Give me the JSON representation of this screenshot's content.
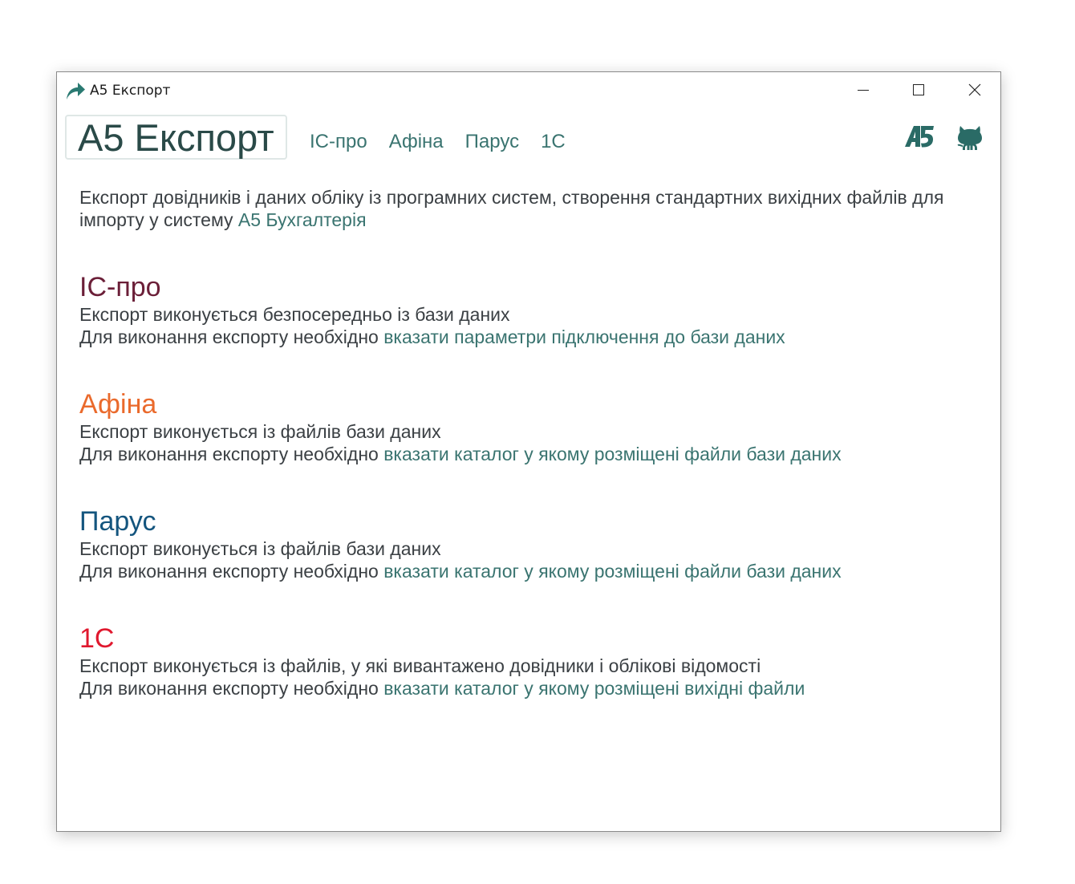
{
  "window": {
    "title": "A5 Експорт"
  },
  "header": {
    "brand": "A5 Експорт",
    "nav": [
      "ІС-про",
      "Афіна",
      "Парус",
      "1С"
    ],
    "icons": [
      "a5-logo-icon",
      "github-icon"
    ]
  },
  "intro": {
    "text": "Експорт довідників і даних обліку із програмних систем, створення стандартних вихідних файлів для імпорту у систему ",
    "link": "A5 Бухгалтерія"
  },
  "sections": [
    {
      "title": "ІС-про",
      "color": "#6b1f38",
      "line1": "Експорт виконується безпосередньо із бази даних",
      "line2_prefix": "Для виконання експорту необхідно ",
      "line2_link": "вказати параметри підключення до бази даних"
    },
    {
      "title": "Афіна",
      "color": "#ea6a2c",
      "line1": "Експорт виконується із файлів бази даних",
      "line2_prefix": "Для виконання експорту необхідно ",
      "line2_link": "вказати каталог у якому розміщені файли бази даних"
    },
    {
      "title": "Парус",
      "color": "#14557e",
      "line1": "Експорт виконується із файлів бази даних",
      "line2_prefix": "Для виконання експорту необхідно ",
      "line2_link": "вказати каталог у якому розміщені файли бази даних"
    },
    {
      "title": "1С",
      "color": "#e0182e",
      "line1": "Експорт виконується із файлів, у які вивантажено довідники і облікові відомості",
      "line2_prefix": "Для виконання експорту необхідно ",
      "line2_link": "вказати каталог у якому розміщені вихідні файли"
    }
  ],
  "colors": {
    "accent": "#3a7470",
    "text": "#3b4044",
    "brand": "#2a4a48"
  }
}
